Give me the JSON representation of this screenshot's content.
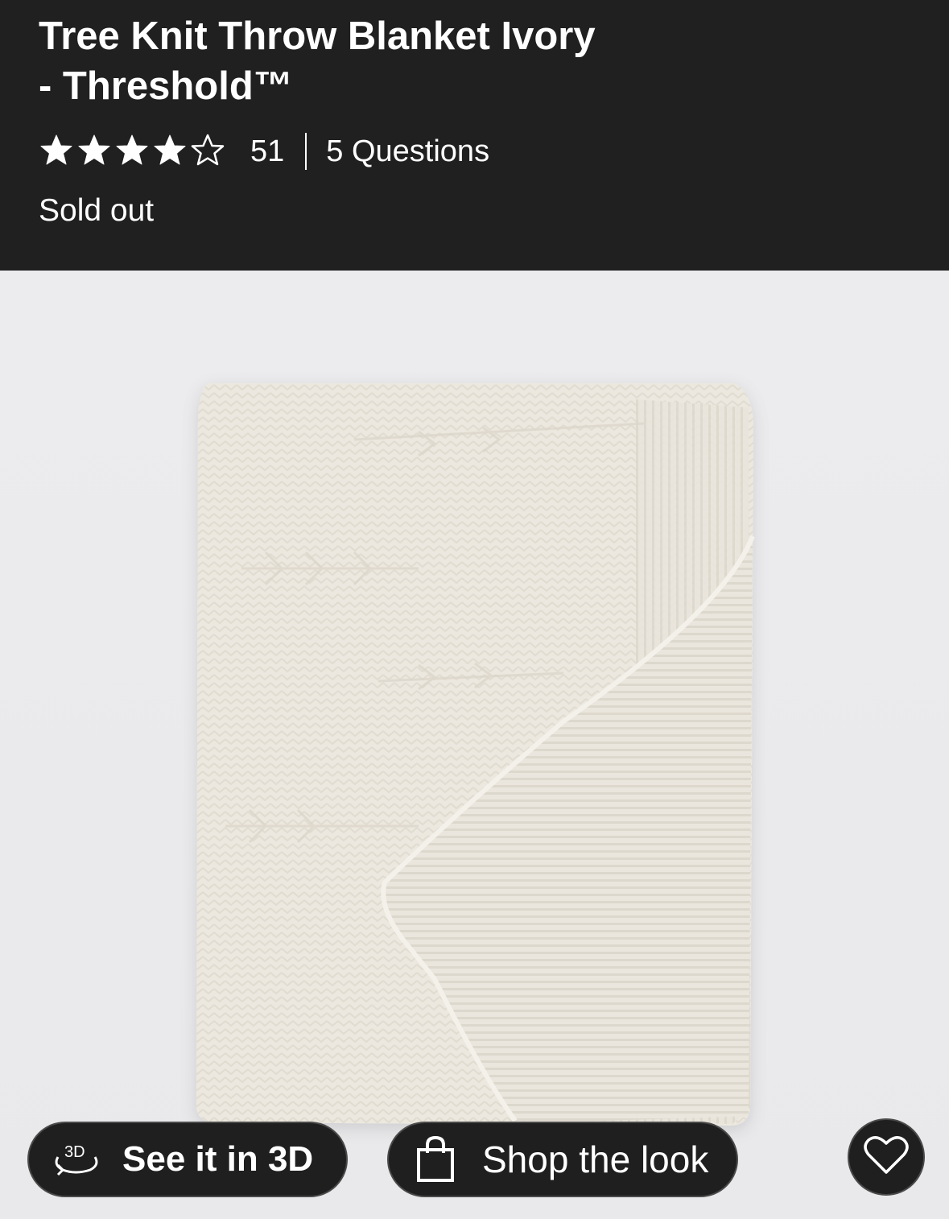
{
  "product": {
    "title_line1": "Tree Knit Throw Blanket Ivory",
    "title_line2": "- Threshold™",
    "rating": 4,
    "rating_max": 5,
    "review_count": "51",
    "questions": "5 Questions",
    "stock_status": "Sold out"
  },
  "actions": {
    "view_3d_label": "See it in 3D",
    "view_3d_icon_text": "3D",
    "shop_look_label": "Shop the look"
  },
  "icons": {
    "star_full": "star-filled-icon",
    "star_empty": "star-outline-icon",
    "rotate_3d": "3d-rotate-icon",
    "bag": "shopping-bag-icon",
    "heart": "heart-outline-icon"
  },
  "colors": {
    "header_bg": "#202020",
    "image_bg": "#ececee",
    "blanket": "#ece8df",
    "button_bg": "#1f1f1f"
  }
}
